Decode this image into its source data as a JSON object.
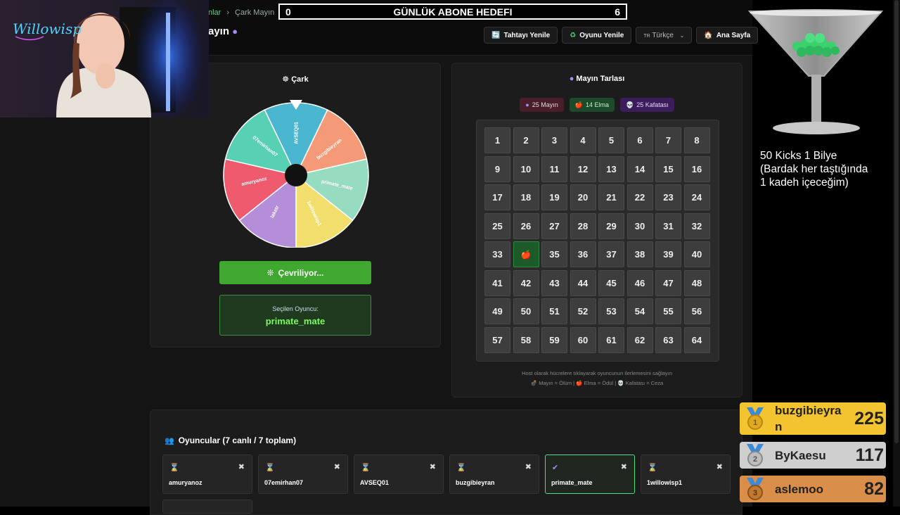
{
  "breadcrumb": {
    "prev": "nlar",
    "sep": "›",
    "current": "Çark Mayın"
  },
  "page_title": "ayın",
  "goal": {
    "left": "0",
    "title": "GÜNLÜK ABONE HEDEFI",
    "right": "6"
  },
  "toolbar": {
    "refresh_board": "Tahtayı Yenile",
    "refresh_game": "Oyunu Yenile",
    "language": "Türkçe",
    "language_flag": "TR",
    "home": "Ana Sayfa"
  },
  "wheel": {
    "title": "Çark",
    "segments": [
      {
        "label": "AVSEQ01",
        "color": "#4bb6cf"
      },
      {
        "label": "buzgibieyran",
        "color": "#f59a79"
      },
      {
        "label": "primate_mate",
        "color": "#95dcc0"
      },
      {
        "label": "1willowisp1",
        "color": "#f2de6d"
      },
      {
        "label": "lakatr",
        "color": "#b48ed8"
      },
      {
        "label": "amuryanoz",
        "color": "#ee5a6e"
      },
      {
        "label": "07emirhan07",
        "color": "#58d0b4"
      }
    ],
    "spin_label": "Çevriliyor...",
    "selected_label": "Seçilen Oyuncu:",
    "selected_player": "primate_mate"
  },
  "mines": {
    "title": "Mayın Tarlası",
    "badge_mines": "25 Mayın",
    "badge_apples": "14 Elma",
    "badge_skulls": "25 Kafatası",
    "cells": [
      "1",
      "2",
      "3",
      "4",
      "5",
      "6",
      "7",
      "8",
      "9",
      "10",
      "11",
      "12",
      "13",
      "14",
      "15",
      "16",
      "17",
      "18",
      "19",
      "20",
      "21",
      "22",
      "23",
      "24",
      "25",
      "26",
      "27",
      "28",
      "29",
      "30",
      "31",
      "32",
      "33",
      "🍎",
      "35",
      "36",
      "37",
      "38",
      "39",
      "40",
      "41",
      "42",
      "43",
      "44",
      "45",
      "46",
      "47",
      "48",
      "49",
      "50",
      "51",
      "52",
      "53",
      "54",
      "55",
      "56",
      "57",
      "58",
      "59",
      "60",
      "61",
      "62",
      "63",
      "64"
    ],
    "revealed_apple_index": 33,
    "hint_line1": "Host olarak hücrelere tıklayarak oyuncunun ilerlemesini sağlayın",
    "hint_line2": "💣 Mayın = Ölüm | 🍎 Elma = Ödül | 💀 Kafatası = Ceza"
  },
  "players": {
    "title": "Oyuncular (7 canlı / 7 toplam)",
    "list": [
      {
        "name": "amuryanoz",
        "status": "⌛",
        "active": false
      },
      {
        "name": "07emirhan07",
        "status": "⌛",
        "active": false
      },
      {
        "name": "AVSEQ01",
        "status": "⌛",
        "active": false
      },
      {
        "name": "buzgibieyran",
        "status": "⌛",
        "active": false
      },
      {
        "name": "primate_mate",
        "status": "✔",
        "active": true
      },
      {
        "name": "1willowisp1",
        "status": "⌛",
        "active": false
      }
    ],
    "remove_icon": "✖"
  },
  "overlay": {
    "kicks_line1": "50 Kicks 1 Bilye",
    "kicks_line2": "(Bardak her taştığında",
    "kicks_line3": "1 kadeh içeceğim)",
    "leaderboard": [
      {
        "rank": "1",
        "name": "buzgibieyra",
        "name2": "n",
        "score": "225"
      },
      {
        "rank": "2",
        "name": "ByKaesu",
        "score": "117"
      },
      {
        "rank": "3",
        "name": "aslemoo",
        "score": "82"
      }
    ]
  },
  "colors": {
    "accent_green": "#3fa82e",
    "selected_text": "#7cfc5c",
    "gold": "#f4c430",
    "silver": "#cfcfcf",
    "bronze": "#d98e4a"
  }
}
